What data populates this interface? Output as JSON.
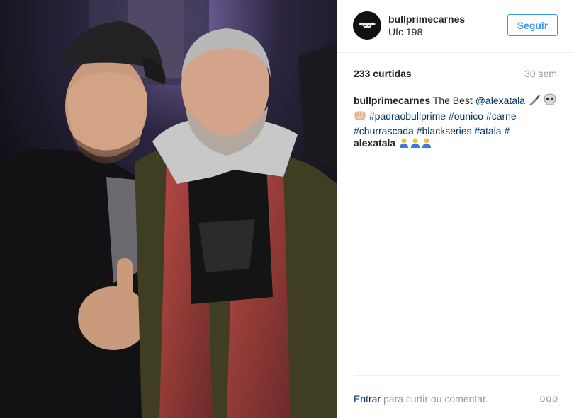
{
  "post": {
    "username": "bullprimecarnes",
    "location": "Ufc 198",
    "follow_label": "Seguir",
    "likes": "233 curtidas",
    "time_ago": "30 sem",
    "caption": {
      "author": "bullprimecarnes",
      "text_start": "The Best",
      "mention": "@alexatala",
      "tags": [
        "#padraobullprime",
        "#ounico",
        "#carne",
        "#churrascada",
        "#blackseries",
        "#atala",
        "#"
      ]
    },
    "comment": {
      "author": "alexatala"
    },
    "login_link": "Entrar",
    "login_text": "para curtir ou comentar.",
    "more_label": "ooo"
  },
  "icons": {
    "avatar": "bull-logo-icon",
    "caption_emojis": [
      "knife-icon",
      "skull-icon",
      "fist-icon"
    ],
    "comment_emojis": [
      "person-bowing-icon",
      "person-bowing-icon",
      "person-bowing-icon"
    ]
  },
  "colors": {
    "accent": "#3897f0",
    "link": "#003569",
    "muted": "#999999",
    "text": "#262626"
  }
}
